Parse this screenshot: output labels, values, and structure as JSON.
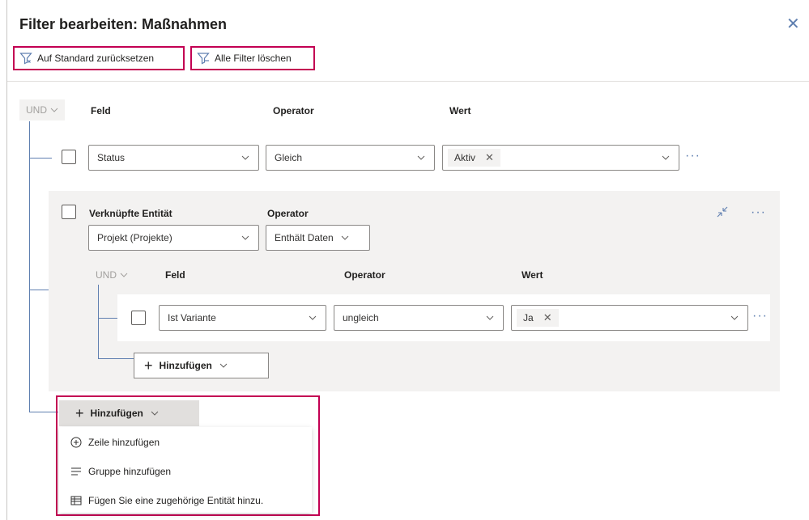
{
  "dialog": {
    "title": "Filter bearbeiten: Maßnahmen",
    "close_icon": "close-icon"
  },
  "commands": {
    "reset_label": "Auf Standard zurücksetzen",
    "clear_label": "Alle Filter löschen",
    "accent": "#c30052"
  },
  "root": {
    "logic": "UND",
    "headers": {
      "field": "Feld",
      "operator": "Operator",
      "value": "Wert"
    },
    "row": {
      "field": "Status",
      "operator": "Gleich",
      "value_tag": "Aktiv"
    }
  },
  "related": {
    "header_entity": "Verknüpfte Entität",
    "header_operator": "Operator",
    "entity": "Projekt (Projekte)",
    "operator": "Enthält Daten",
    "logic": "UND",
    "headers": {
      "field": "Feld",
      "operator": "Operator",
      "value": "Wert"
    },
    "row": {
      "field": "Ist Variante",
      "operator": "ungleich",
      "value_tag": "Ja"
    },
    "add_label": "Hinzufügen"
  },
  "add_menu": {
    "button_label": "Hinzufügen",
    "items": [
      {
        "label": "Zeile hinzufügen",
        "icon": "add-circle-icon"
      },
      {
        "label": "Gruppe hinzufügen",
        "icon": "group-list-icon"
      },
      {
        "label": "Fügen Sie eine zugehörige Entität hinzu.",
        "icon": "related-entity-icon"
      }
    ]
  }
}
